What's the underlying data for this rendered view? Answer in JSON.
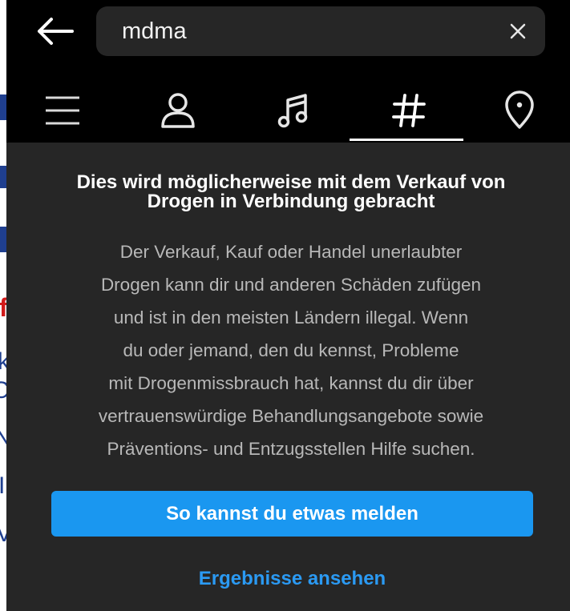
{
  "background_page": {
    "fragments": [
      "f",
      "k",
      "C",
      "N",
      "I",
      "V"
    ]
  },
  "search": {
    "value": "mdma",
    "back_icon": "arrow-left-icon",
    "clear_icon": "close-icon"
  },
  "tabs": [
    {
      "name": "menu",
      "icon": "hamburger-menu-icon"
    },
    {
      "name": "accounts",
      "icon": "person-icon"
    },
    {
      "name": "audio",
      "icon": "music-note-icon"
    },
    {
      "name": "tags",
      "icon": "hashtag-icon",
      "selected": true
    },
    {
      "name": "places",
      "icon": "location-pin-icon"
    }
  ],
  "dialog": {
    "title_line1": "Dies wird möglicherweise mit dem Verkauf von",
    "title_line2": "Drogen in Verbindung gebracht",
    "body_lines": [
      "Der Verkauf, Kauf oder Handel unerlaubter",
      "Drogen kann dir und anderen Schäden zufügen",
      "und ist in den meisten Ländern illegal. Wenn",
      "du oder jemand, den du kennst, Probleme",
      "mit Drogenmissbrauch hat, kannst du dir über",
      "vertrauenswürdige Behandlungsangebote sowie",
      "Präventions- und Entzugsstellen Hilfe suchen."
    ],
    "primary_button": "So kannst du etwas melden",
    "secondary_link": "Ergebnisse ansehen"
  },
  "colors": {
    "topbar": "#000000",
    "dialog_bg": "#262626",
    "primary_button": "#1a97f0",
    "link": "#2b9af3"
  }
}
